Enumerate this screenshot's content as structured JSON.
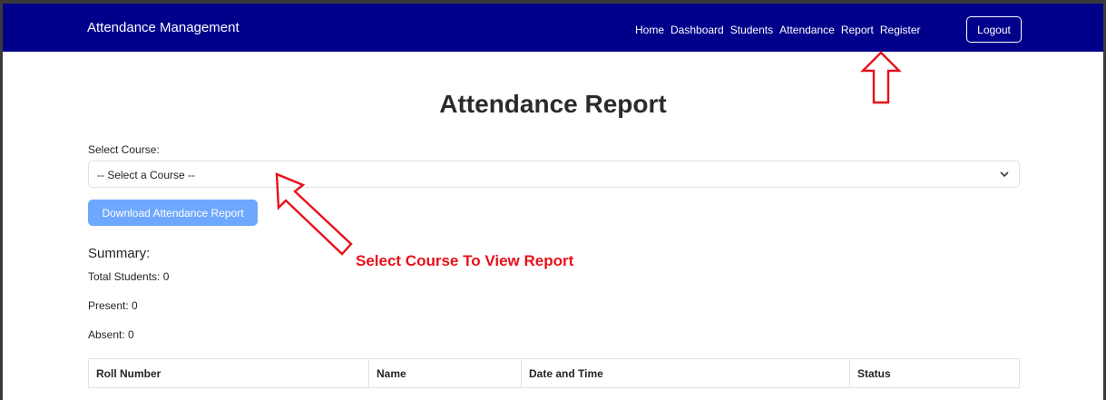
{
  "navbar": {
    "brand": "Attendance Management",
    "links": [
      "Home",
      "Dashboard",
      "Students",
      "Attendance",
      "Report",
      "Register"
    ],
    "logout": "Logout"
  },
  "page": {
    "title": "Attendance Report"
  },
  "course": {
    "label": "Select Course:",
    "selected": "-- Select a Course --"
  },
  "download_button": "Download Attendance Report",
  "summary": {
    "title": "Summary:",
    "total": "Total Students: 0",
    "present": "Present: 0",
    "absent": "Absent: 0"
  },
  "table": {
    "headers": [
      "Roll Number",
      "Name",
      "Date and Time",
      "Status"
    ]
  },
  "annotation": {
    "callout": "Select Course To View Report",
    "color": "#e8101a"
  },
  "colors": {
    "navbar": "#00008b",
    "button": "#6ea8fe"
  }
}
